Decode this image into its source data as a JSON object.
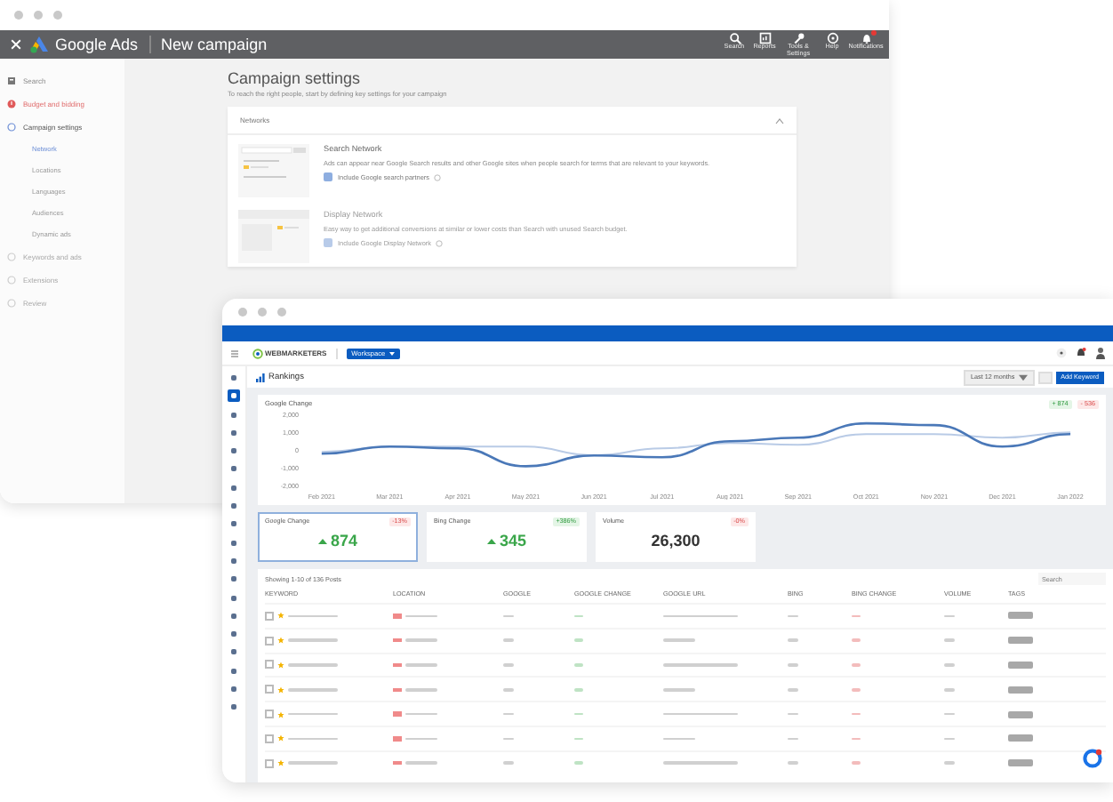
{
  "ads_window": {
    "app_name": "Google Ads",
    "page_title": "New campaign",
    "toolbar": [
      {
        "label": "Search",
        "alert": false
      },
      {
        "label": "Reports",
        "alert": false
      },
      {
        "label": "Tools & Settings",
        "alert": false
      },
      {
        "label": "Help",
        "alert": false
      },
      {
        "label": "Notifications",
        "alert": true
      }
    ],
    "steps": [
      {
        "label": "Search",
        "kind": "type"
      },
      {
        "label": "Budget and bidding",
        "kind": "error"
      },
      {
        "label": "Campaign settings",
        "kind": "current",
        "children": [
          {
            "label": "Network",
            "selected": true
          },
          {
            "label": "Locations",
            "selected": false
          },
          {
            "label": "Languages",
            "selected": false
          },
          {
            "label": "Audiences",
            "selected": false
          },
          {
            "label": "Dynamic ads",
            "selected": false
          }
        ]
      },
      {
        "label": "Keywords and ads",
        "kind": "pending"
      },
      {
        "label": "Extensions",
        "kind": "pending"
      },
      {
        "label": "Review",
        "kind": "pending"
      }
    ],
    "heading": "Campaign settings",
    "subheading": "To reach the right people, start by defining key settings for your campaign",
    "panel": {
      "title": "Networks",
      "expanded": true,
      "options": [
        {
          "title": "Search Network",
          "description": "Ads can appear near Google Search results and other Google sites when people search for terms that are relevant to your keywords.",
          "checkbox_label": "Include Google search partners",
          "checked": true,
          "disabled": false
        },
        {
          "title": "Display Network",
          "description": "Easy way to get additional conversions at similar or lower costs than Search with unused Search budget.",
          "checkbox_label": "Include Google Display Network",
          "checked": true,
          "disabled": true
        }
      ]
    }
  },
  "rankings_window": {
    "brand": "WEBMARKETERS",
    "workspace": "Workspace",
    "page_title": "Rankings",
    "date_range": "Last 12 months",
    "add_button": "Add Keyword",
    "nav_items": [
      {
        "selected": false
      },
      {
        "selected": true
      },
      {
        "selected": false
      },
      {
        "selected": false
      },
      {
        "selected": false
      },
      {
        "selected": false
      },
      {
        "selected": false
      },
      {
        "selected": false
      },
      {
        "selected": false
      },
      {
        "selected": false
      },
      {
        "selected": false
      },
      {
        "selected": false
      },
      {
        "selected": false
      },
      {
        "selected": false
      },
      {
        "selected": false
      },
      {
        "selected": false
      },
      {
        "selected": false
      },
      {
        "selected": false
      },
      {
        "selected": false
      }
    ],
    "chart": {
      "legend": [
        {
          "text": "+ 874",
          "kind": "up"
        },
        {
          "text": "- 536",
          "kind": "down"
        }
      ],
      "chart_data": {
        "type": "line",
        "title": "Google Change",
        "categories": [
          "Feb 2021",
          "Mar 2021",
          "Apr 2021",
          "May 2021",
          "Jun 2021",
          "Jul 2021",
          "Aug 2021",
          "Sep 2021",
          "Oct 2021",
          "Nov 2021",
          "Dec 2021",
          "Jan 2022"
        ],
        "ylim": [
          -2000,
          2000
        ],
        "yticks": [
          {
            "value": 2000,
            "label": "2,000"
          },
          {
            "value": 1000,
            "label": "1,000"
          },
          0,
          {
            "value": -1000,
            "label": "-1,000"
          },
          {
            "value": -2000,
            "label": "-2,000"
          }
        ],
        "series": [
          {
            "color": "#4a78b8",
            "values": [
              -200,
              200,
              100,
              -900,
              -300,
              -400,
              500,
              700,
              1500,
              1400,
              200,
              900
            ]
          },
          {
            "color": "#b9cbe6",
            "values": [
              -100,
              200,
              200,
              200,
              -300,
              100,
              400,
              300,
              900,
              900,
              700,
              1000
            ]
          }
        ]
      }
    },
    "cards": [
      {
        "label": "Google Change",
        "badge": {
          "text": "-13%",
          "kind": "down"
        },
        "value": "874",
        "rising": true,
        "selected": true
      },
      {
        "label": "Bing Change",
        "badge": {
          "text": "+386%",
          "kind": "up"
        },
        "value": "345",
        "rising": true,
        "selected": false
      },
      {
        "label": "Volume",
        "badge": {
          "text": "-0%",
          "kind": "down"
        },
        "value": "26,300",
        "rising": false,
        "selected": false
      }
    ],
    "table": {
      "caption": "Showing 1-10 of 136 Posts",
      "search_placeholder": "Search",
      "columns": [
        "KEYWORD",
        "LOCATION",
        "GOOGLE",
        "GOOGLE CHANGE",
        "GOOGLE URL",
        "BING",
        "BING CHANGE",
        "VOLUME",
        "TAGS"
      ],
      "rows": [
        {
          "checked": false,
          "starred": true
        },
        {
          "checked": false,
          "starred": true
        },
        {
          "checked": false,
          "starred": true
        },
        {
          "checked": false,
          "starred": true
        },
        {
          "checked": false,
          "starred": true
        },
        {
          "checked": false,
          "starred": true
        },
        {
          "checked": false,
          "starred": true
        }
      ]
    }
  }
}
